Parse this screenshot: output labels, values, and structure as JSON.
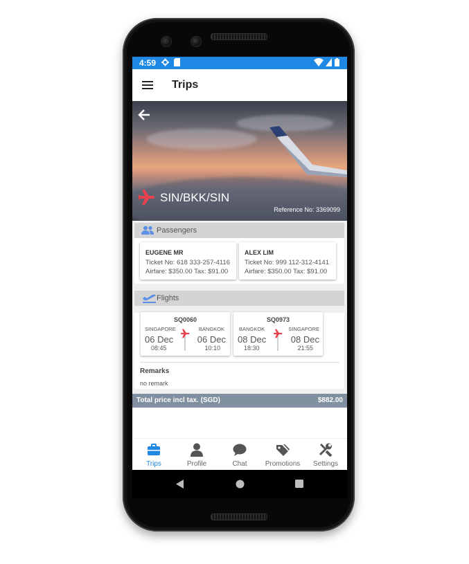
{
  "status_bar": {
    "time": "4:59"
  },
  "app_bar": {
    "title": "Trips"
  },
  "trip": {
    "route": "SIN/BKK/SIN",
    "reference": "Reference No: 3369099"
  },
  "passengers": {
    "heading": "Passengers",
    "items": [
      {
        "name": "EUGENE MR",
        "ticket": "Ticket No: 618 333-257-4116",
        "fare": "Airfare: $350.00  Tax: $91.00"
      },
      {
        "name": "ALEX LIM",
        "ticket": "Ticket No: 999 112-312-4141",
        "fare": "Airfare: $350.00  Tax: $91.00"
      }
    ]
  },
  "flights": {
    "heading": "Flights",
    "items": [
      {
        "code": "SQ0060",
        "from_city": "SINGAPORE",
        "to_city": "BANGKOK",
        "dep_date": "06 Dec",
        "arr_date": "06 Dec",
        "dep_time": "08:45",
        "arr_time": "10:10"
      },
      {
        "code": "SQ0973",
        "from_city": "BANGKOK",
        "to_city": "SINGAPORE",
        "dep_date": "08 Dec",
        "arr_date": "08 Dec",
        "dep_time": "18:30",
        "arr_time": "21:55"
      }
    ]
  },
  "remarks": {
    "label": "Remarks",
    "text": "no remark"
  },
  "total": {
    "label": "Total price incl tax.  (SGD)",
    "value": "$882.00"
  },
  "bottom_nav": {
    "items": [
      {
        "label": "Trips",
        "icon": "briefcase-icon",
        "active": true
      },
      {
        "label": "Profile",
        "icon": "person-icon"
      },
      {
        "label": "Chat",
        "icon": "chat-bubble-icon"
      },
      {
        "label": "Promotions",
        "icon": "tags-icon"
      },
      {
        "label": "Settings",
        "icon": "tools-icon"
      }
    ]
  },
  "colors": {
    "accent": "#1e88e5",
    "plane_icon": "#e8424e",
    "total_bar": "#8090a0",
    "section_icon": "#5c8fe6"
  }
}
